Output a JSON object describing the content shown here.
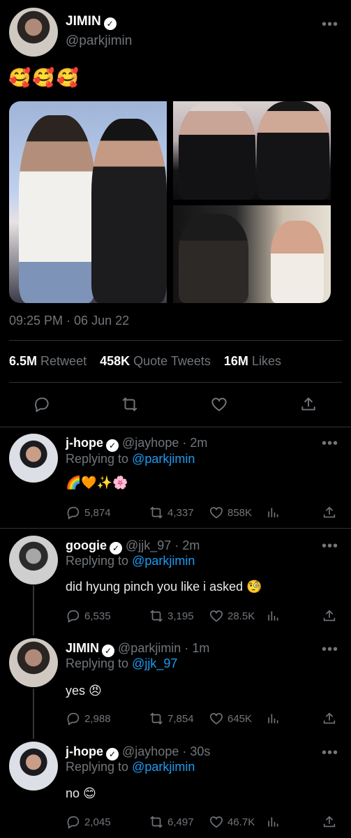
{
  "main": {
    "name": "JIMIN",
    "handle": "@parkjimin",
    "text": "🥰🥰🥰",
    "timestamp": "09:25 PM · 06 Jun 22",
    "stats": {
      "retweets": "6.5M",
      "retweets_label": "Retweet",
      "quotes": "458K",
      "quotes_label": "Quote Tweets",
      "likes": "16M",
      "likes_label": "Likes"
    }
  },
  "replies": [
    {
      "name": "j-hope",
      "handle": "@jayhope",
      "time": "· 2m",
      "replying_prefix": "Replying to",
      "replying_to": "@parkjimin",
      "text": "🌈🧡✨🌸",
      "replies": "5,874",
      "retweets": "4,337",
      "likes": "858K"
    },
    {
      "name": "googie",
      "handle": "@jjk_97",
      "time": "· 2m",
      "replying_prefix": "Replying to",
      "replying_to": "@parkjimin",
      "text": "did hyung pinch you like i asked 🧐",
      "replies": "6,535",
      "retweets": "3,195",
      "likes": "28.5K"
    },
    {
      "name": "JIMIN",
      "handle": "@parkjimin",
      "time": "· 1m",
      "replying_prefix": "Replying to",
      "replying_to": "@jjk_97",
      "text": "yes 😠",
      "replies": "2,988",
      "retweets": "7,854",
      "likes": "645K"
    },
    {
      "name": "j-hope",
      "handle": "@jayhope",
      "time": "· 30s",
      "replying_prefix": "Replying to",
      "replying_to": "@parkjimin",
      "text": "no 😊",
      "replies": "2,045",
      "retweets": "6,497",
      "likes": "46.7K"
    }
  ],
  "icons": {
    "more": "more-icon",
    "verified": "verified-icon",
    "reply": "reply-icon",
    "retweet": "retweet-icon",
    "like": "like-icon",
    "share": "share-icon",
    "analytics": "analytics-icon"
  },
  "colors": {
    "background": "#000000",
    "link": "#1d9bf0",
    "muted": "#71767b",
    "divider": "#2f3336"
  }
}
